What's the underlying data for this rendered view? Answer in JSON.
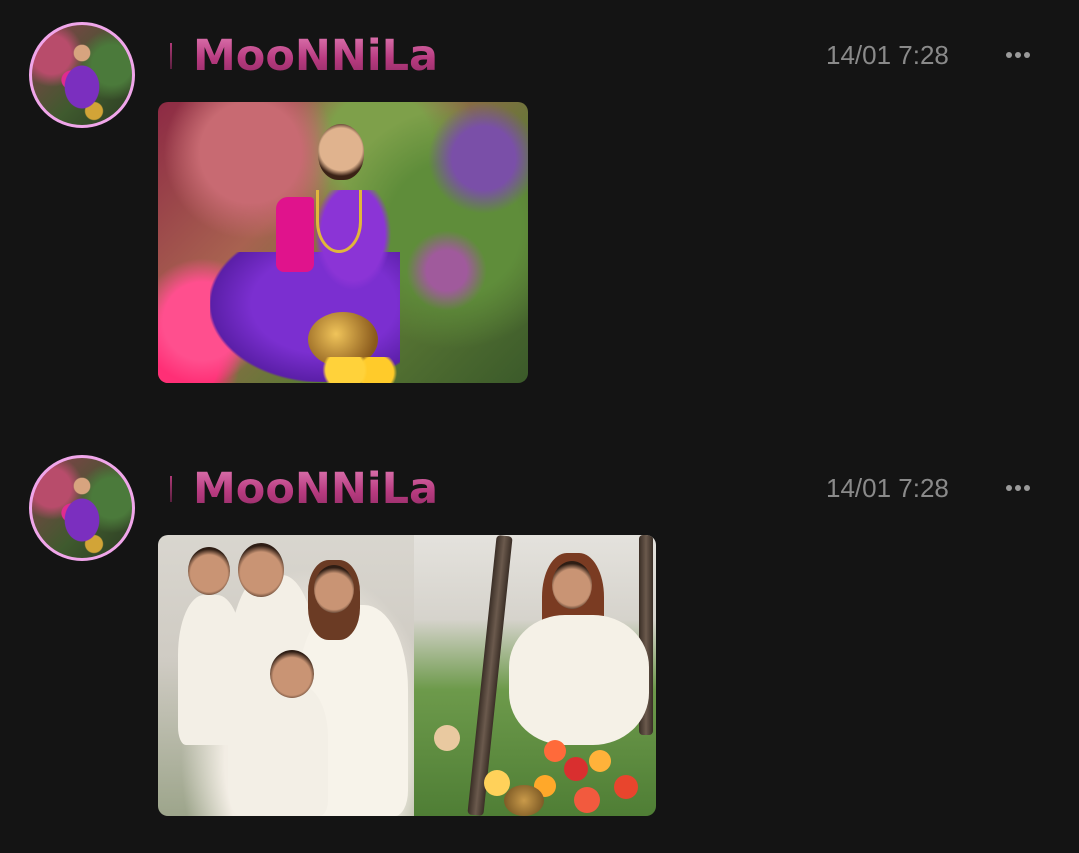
{
  "posts": [
    {
      "username": "MooNNiLa",
      "timestamp": "14/01 7:28",
      "avatar_icon": "user-avatar-icon",
      "more_icon": "more-options-icon",
      "image_count": 1
    },
    {
      "username": "MooNNiLa",
      "timestamp": "14/01 7:28",
      "avatar_icon": "user-avatar-icon",
      "more_icon": "more-options-icon",
      "image_count": 2
    }
  ],
  "colors": {
    "background": "#141414",
    "username_gradient_top": "#e07ab3",
    "username_gradient_bottom": "#8e2a63",
    "avatar_ring": "#f0a6ea",
    "timestamp": "#8a8a8a",
    "more_dots": "#9a9a9a"
  }
}
